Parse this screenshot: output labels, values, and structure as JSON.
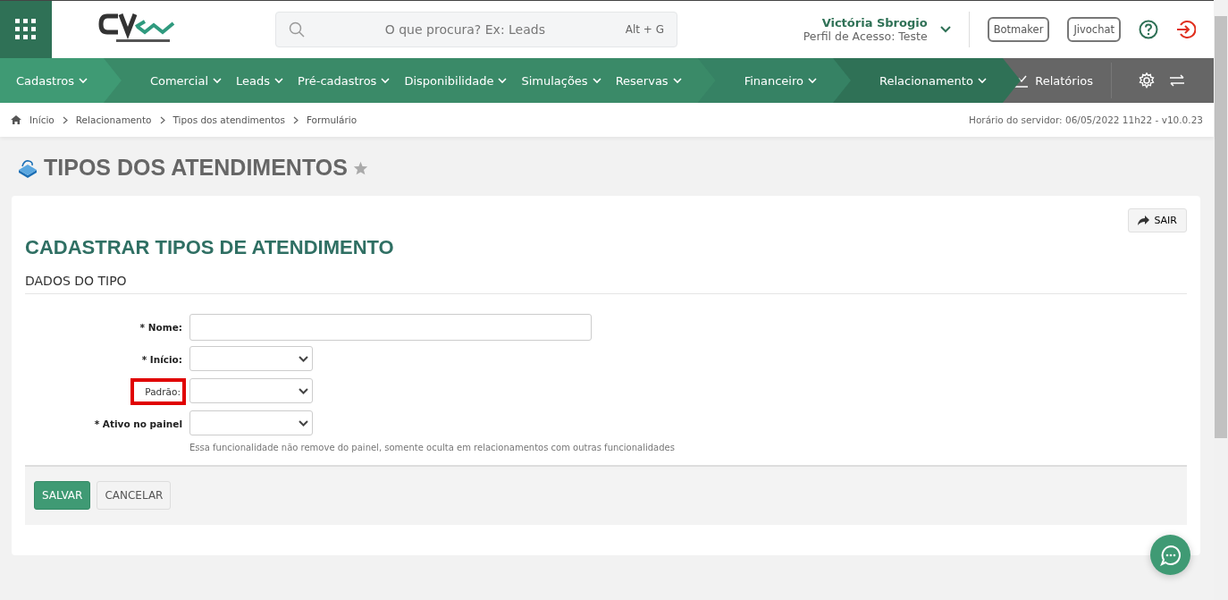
{
  "header": {
    "search": {
      "placeholder": "O que procura? Ex: Leads",
      "shortcut": "Alt + G"
    },
    "user": {
      "name": "Victória Sbrogio",
      "profile": "Perfil de Acesso: Teste"
    },
    "buttons": [
      "Botmaker",
      "Jivochat"
    ]
  },
  "nav": {
    "groups": [
      {
        "color": "#3f9a74",
        "items": [
          "Cadastros"
        ]
      },
      {
        "color": "#3a8a68",
        "items": [
          "Comercial",
          "Leads",
          "Pré-cadastros",
          "Disponibilidade",
          "Simulações",
          "Reservas"
        ]
      },
      {
        "color": "#368264",
        "items": [
          "Financeiro"
        ]
      },
      {
        "color": "#2f7156",
        "items": [
          "Relacionamento"
        ]
      }
    ],
    "reports": "Relatórios"
  },
  "breadcrumb": [
    "Início",
    "Relacionamento",
    "Tipos dos atendimentos",
    "Formulário"
  ],
  "server_time": "Horário do servidor: 06/05/2022 11h22 - v10.0.23",
  "page_title": "TIPOS DOS ATENDIMENTOS",
  "exit_button": "SAIR",
  "form": {
    "title": "CADASTRAR TIPOS DE ATENDIMENTO",
    "section": "DADOS DO TIPO",
    "fields": [
      {
        "label": "* Nome:",
        "kind": "text",
        "required": true,
        "highlighted": false
      },
      {
        "label": "* Início:",
        "kind": "select",
        "required": true,
        "highlighted": false
      },
      {
        "label": "Padrão:",
        "kind": "select",
        "required": false,
        "highlighted": true
      },
      {
        "label": "* Ativo no painel",
        "kind": "select",
        "required": true,
        "highlighted": false,
        "help": "Essa funcionalidade não remove do painel, somente oculta em relacionamentos com outras funcionalidades"
      }
    ],
    "save": "SALVAR",
    "cancel": "CANCELAR"
  }
}
